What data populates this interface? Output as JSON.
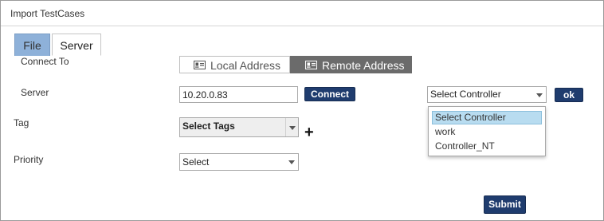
{
  "dialog": {
    "title": "Import TestCases"
  },
  "tabs": [
    {
      "label": "File",
      "active": false
    },
    {
      "label": "Server",
      "active": true
    }
  ],
  "connect_to": {
    "label": "Connect To",
    "options": [
      {
        "label": "Local Address",
        "icon": "id-card-icon",
        "selected": false
      },
      {
        "label": "Remote Address",
        "icon": "id-card-icon",
        "selected": true
      }
    ]
  },
  "server": {
    "label": "Server",
    "value": "10.20.0.83",
    "connect_label": "Connect"
  },
  "controller": {
    "selected": "Select Controller",
    "ok_label": "ok",
    "options": [
      "Select Controller",
      "work",
      "Controller_NT"
    ],
    "highlighted": "Select Controller"
  },
  "tag": {
    "label": "Tag",
    "selected": "Select Tags",
    "add_symbol": "+"
  },
  "priority": {
    "label": "Priority",
    "selected": "Select"
  },
  "footer": {
    "submit_label": "Submit"
  },
  "colors": {
    "primary_button": "#1f3c6e",
    "segment_active": "#6b6b6b",
    "tab_inactive": "#8eb1d9",
    "option_highlight": "#b8dcf0"
  }
}
